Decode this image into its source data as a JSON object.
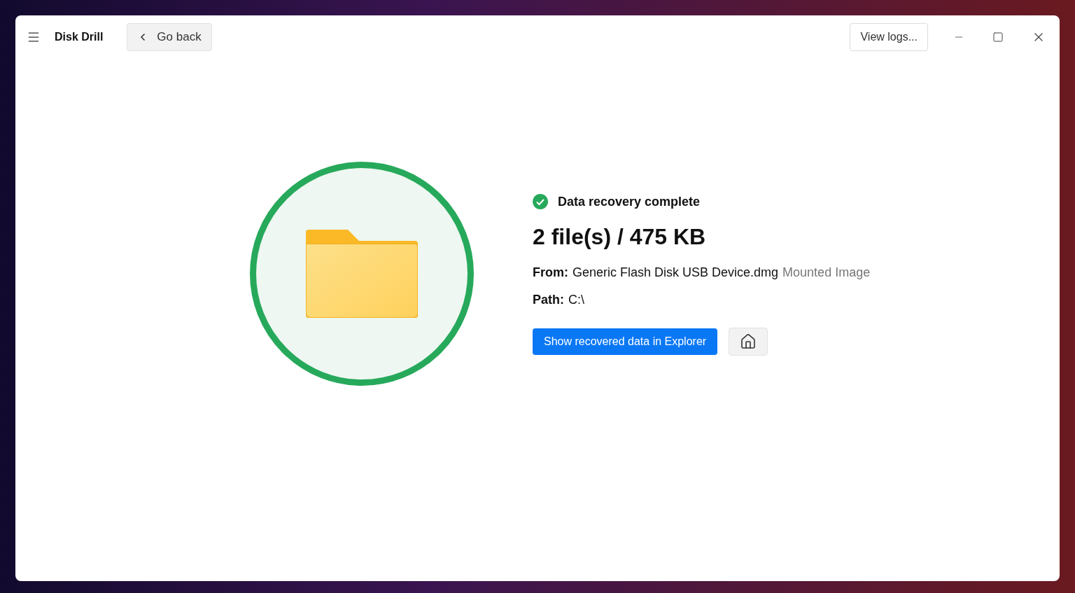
{
  "window": {
    "title": "Disk Drill"
  },
  "toolbar": {
    "back_button": "Go back",
    "logs_button": "View logs..."
  },
  "result": {
    "status": "Data recovery complete",
    "summary": "2 file(s) / 475 KB",
    "from_label": "From:",
    "from_value": "Generic Flash Disk USB Device.dmg",
    "from_type": "Mounted Image",
    "path_label": "Path:",
    "path_value": "C:\\",
    "primary_button": "Show recovered data in Explorer"
  }
}
